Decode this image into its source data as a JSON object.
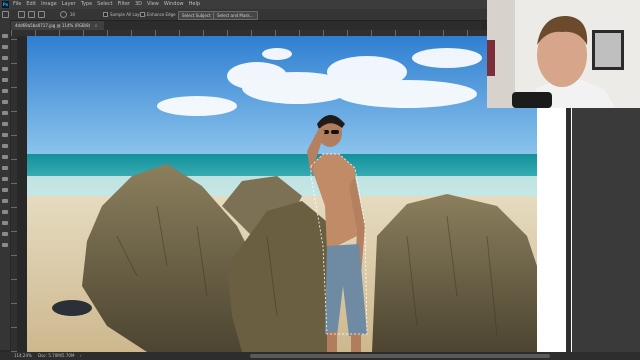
{
  "app": {
    "logo": "Ps"
  },
  "menu": [
    "File",
    "Edit",
    "Image",
    "Layer",
    "Type",
    "Select",
    "Filter",
    "3D",
    "View",
    "Window",
    "Help"
  ],
  "options": {
    "size_value": "30",
    "sample_all_layers": "Sample All Layers",
    "enhance_edge": "Enhance Edge",
    "select_subject": "Select Subject",
    "select_and_mask": "Select and Mask..."
  },
  "document_tab": {
    "label": "4dd69a5ba0717.jpg @ 114% (RGB/8)",
    "close": "×"
  },
  "status": {
    "zoom": "114.24%",
    "doc": "Doc: 5.70M/5.70M",
    "arrow": "›"
  },
  "colors": {
    "sky_top": "#2f7fd1",
    "sea": "#1aa7b4",
    "sand": "#d9c9a6",
    "rock": "#6f6447"
  }
}
